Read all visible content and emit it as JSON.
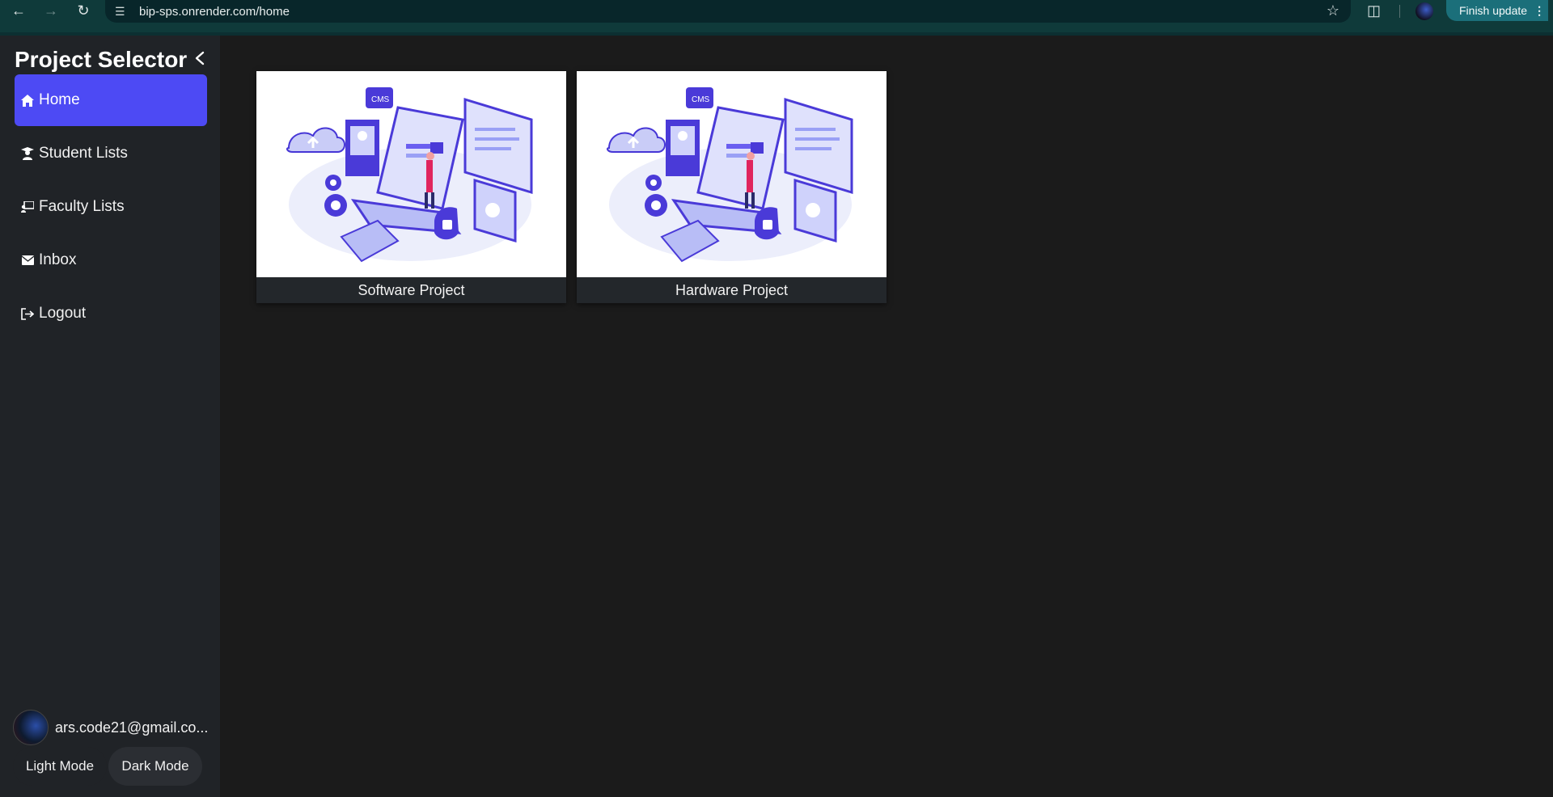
{
  "browser": {
    "url": "bip-sps.onrender.com/home",
    "update_label": "Finish update"
  },
  "sidebar": {
    "title": "Project Selector",
    "items": [
      {
        "label": "Home",
        "icon": "home-icon",
        "active": true
      },
      {
        "label": "Student Lists",
        "icon": "student-icon"
      },
      {
        "label": "Faculty Lists",
        "icon": "faculty-icon"
      },
      {
        "label": "Inbox",
        "icon": "mail-icon"
      },
      {
        "label": "Logout",
        "icon": "logout-icon"
      }
    ],
    "user_email": "ars.code21@gmail.co...",
    "light_mode_label": "Light Mode",
    "dark_mode_label": "Dark Mode"
  },
  "projects": [
    {
      "label": "Software Project"
    },
    {
      "label": "Hardware Project"
    }
  ],
  "colors": {
    "accent": "#4d4af4",
    "sidebar_bg": "#202327",
    "main_bg": "#1b1b1b"
  }
}
